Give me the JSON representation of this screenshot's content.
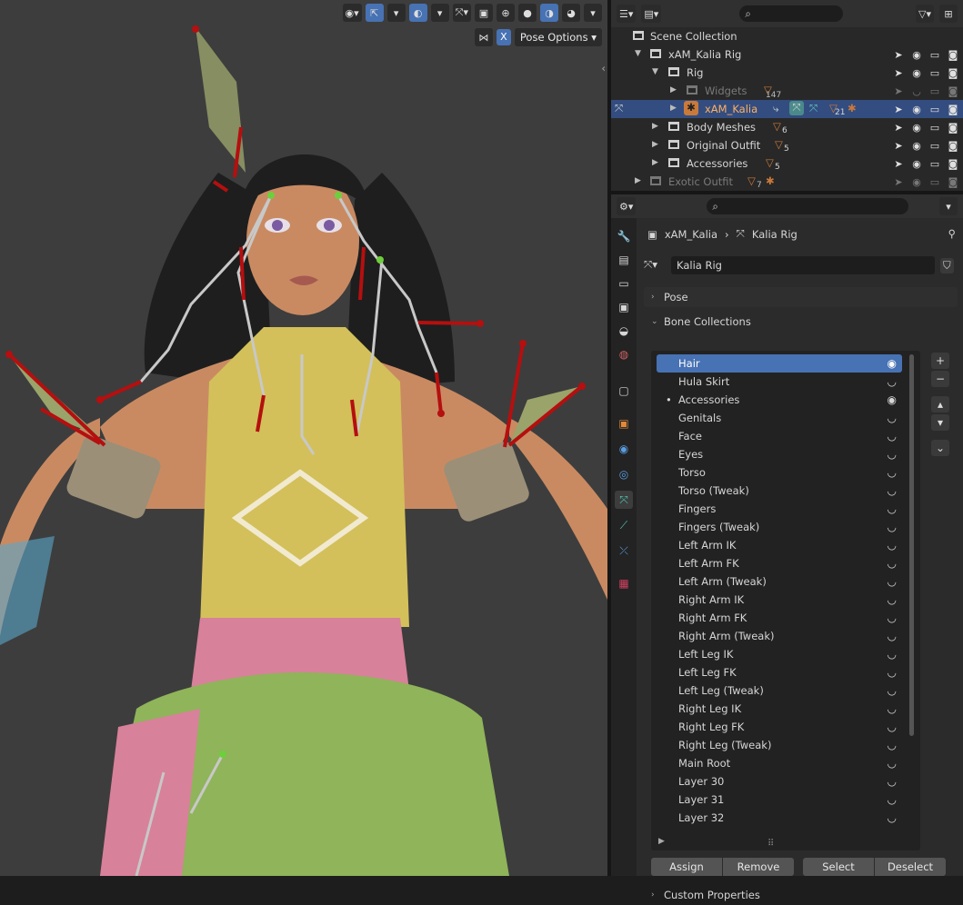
{
  "viewport": {
    "pose_options": "Pose Options",
    "x_toggle": "X"
  },
  "outliner": {
    "rows": [
      {
        "label": "Scene Collection"
      },
      {
        "label": "xAM_Kalia Rig"
      },
      {
        "label": "Rig"
      },
      {
        "label": "Widgets",
        "badge": "147"
      },
      {
        "label": "xAM_Kalia",
        "badge": "21"
      },
      {
        "label": "Body Meshes",
        "badge": "6"
      },
      {
        "label": "Original Outfit",
        "badge": "5"
      },
      {
        "label": "Accessories",
        "badge": "5"
      },
      {
        "label": "Exotic Outfit",
        "badge": "7"
      }
    ]
  },
  "properties": {
    "breadcrumb_object": "xAM_Kalia",
    "breadcrumb_data": "Kalia Rig",
    "armature_name": "Kalia Rig",
    "pose_panel": "Pose",
    "bone_collections_panel": "Bone Collections",
    "custom_properties_panel": "Custom Properties",
    "collections": [
      {
        "name": "Hair",
        "visible": true,
        "selected": true
      },
      {
        "name": "Hula Skirt",
        "visible": false
      },
      {
        "name": "Accessories",
        "visible": true,
        "active_dot": true
      },
      {
        "name": "Genitals",
        "visible": false
      },
      {
        "name": "Face",
        "visible": false
      },
      {
        "name": "Eyes",
        "visible": false
      },
      {
        "name": "Torso",
        "visible": false
      },
      {
        "name": "Torso (Tweak)",
        "visible": false
      },
      {
        "name": "Fingers",
        "visible": false
      },
      {
        "name": "Fingers (Tweak)",
        "visible": false
      },
      {
        "name": "Left Arm IK",
        "visible": false
      },
      {
        "name": "Left Arm FK",
        "visible": false
      },
      {
        "name": "Left Arm (Tweak)",
        "visible": false
      },
      {
        "name": "Right Arm IK",
        "visible": false
      },
      {
        "name": "Right Arm FK",
        "visible": false
      },
      {
        "name": "Right Arm (Tweak)",
        "visible": false
      },
      {
        "name": "Left Leg IK",
        "visible": false
      },
      {
        "name": "Left Leg FK",
        "visible": false
      },
      {
        "name": "Left Leg (Tweak)",
        "visible": false
      },
      {
        "name": "Right Leg IK",
        "visible": false
      },
      {
        "name": "Right Leg FK",
        "visible": false
      },
      {
        "name": "Right Leg (Tweak)",
        "visible": false
      },
      {
        "name": "Main Root",
        "visible": false
      },
      {
        "name": "Layer 30",
        "visible": false
      },
      {
        "name": "Layer 31",
        "visible": false
      },
      {
        "name": "Layer 32",
        "visible": false
      }
    ],
    "buttons": {
      "assign": "Assign",
      "remove": "Remove",
      "select": "Select",
      "deselect": "Deselect"
    }
  },
  "colors": {
    "selection": "#4772b3",
    "outliner_selection": "#334d80",
    "bone_red": "#b50f0f",
    "bone_green": "#6ecf3c"
  }
}
